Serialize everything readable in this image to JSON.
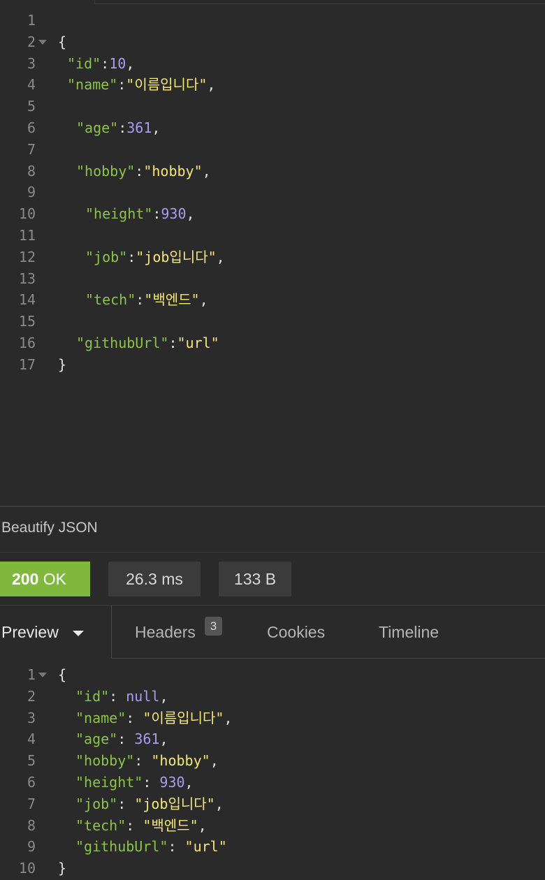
{
  "request_editor": {
    "lines": [
      {
        "num": "1",
        "tokens": []
      },
      {
        "num": "2",
        "fold": true,
        "tokens": [
          {
            "t": "p",
            "v": "{"
          }
        ]
      },
      {
        "num": "3",
        "indent": 1,
        "tokens": [
          {
            "t": "k",
            "v": "\"id\""
          },
          {
            "t": "p",
            "v": ":"
          },
          {
            "t": "n",
            "v": "10"
          },
          {
            "t": "p",
            "v": ","
          }
        ]
      },
      {
        "num": "4",
        "indent": 1,
        "tokens": [
          {
            "t": "k",
            "v": "\"name\""
          },
          {
            "t": "p",
            "v": ":"
          },
          {
            "t": "s",
            "v": "\"이름입니다\""
          },
          {
            "t": "p",
            "v": ","
          }
        ]
      },
      {
        "num": "5",
        "tokens": []
      },
      {
        "num": "6",
        "indent": 2,
        "tokens": [
          {
            "t": "k",
            "v": "\"age\""
          },
          {
            "t": "p",
            "v": ":"
          },
          {
            "t": "n",
            "v": "361"
          },
          {
            "t": "p",
            "v": ","
          }
        ]
      },
      {
        "num": "7",
        "tokens": []
      },
      {
        "num": "8",
        "indent": 2,
        "tokens": [
          {
            "t": "k",
            "v": "\"hobby\""
          },
          {
            "t": "p",
            "v": ":"
          },
          {
            "t": "s",
            "v": "\"hobby\""
          },
          {
            "t": "p",
            "v": ","
          }
        ]
      },
      {
        "num": "9",
        "tokens": []
      },
      {
        "num": "10",
        "indent": 3,
        "tokens": [
          {
            "t": "k",
            "v": "\"height\""
          },
          {
            "t": "p",
            "v": ":"
          },
          {
            "t": "n",
            "v": "930"
          },
          {
            "t": "p",
            "v": ","
          }
        ]
      },
      {
        "num": "11",
        "tokens": []
      },
      {
        "num": "12",
        "indent": 3,
        "tokens": [
          {
            "t": "k",
            "v": "\"job\""
          },
          {
            "t": "p",
            "v": ":"
          },
          {
            "t": "s",
            "v": "\"job입니다\""
          },
          {
            "t": "p",
            "v": ","
          }
        ]
      },
      {
        "num": "13",
        "tokens": []
      },
      {
        "num": "14",
        "indent": 3,
        "tokens": [
          {
            "t": "k",
            "v": "\"tech\""
          },
          {
            "t": "p",
            "v": ":"
          },
          {
            "t": "s",
            "v": "\"백엔드\""
          },
          {
            "t": "p",
            "v": ","
          }
        ]
      },
      {
        "num": "15",
        "tokens": []
      },
      {
        "num": "16",
        "indent": 2,
        "tokens": [
          {
            "t": "k",
            "v": "\"githubUrl\""
          },
          {
            "t": "p",
            "v": ":"
          },
          {
            "t": "s",
            "v": "\"url\""
          }
        ]
      },
      {
        "num": "17",
        "tokens": [
          {
            "t": "p",
            "v": "}"
          }
        ]
      }
    ]
  },
  "beautify_label": "Beautify JSON",
  "status": {
    "code": "200",
    "text": "OK",
    "time": "26.3 ms",
    "size": "133 B"
  },
  "tabs": {
    "preview": "Preview",
    "headers": "Headers",
    "headers_count": "3",
    "cookies": "Cookies",
    "timeline": "Timeline"
  },
  "response_preview": {
    "lines": [
      {
        "num": "1",
        "fold": true,
        "tokens": [
          {
            "t": "p",
            "v": "{"
          }
        ]
      },
      {
        "num": "2",
        "indent": 1,
        "tokens": [
          {
            "t": "k",
            "v": "\"id\""
          },
          {
            "t": "p",
            "v": ": "
          },
          {
            "t": "nl",
            "v": "null"
          },
          {
            "t": "p",
            "v": ","
          }
        ]
      },
      {
        "num": "3",
        "indent": 1,
        "tokens": [
          {
            "t": "k",
            "v": "\"name\""
          },
          {
            "t": "p",
            "v": ": "
          },
          {
            "t": "s",
            "v": "\"이름입니다\""
          },
          {
            "t": "p",
            "v": ","
          }
        ]
      },
      {
        "num": "4",
        "indent": 1,
        "tokens": [
          {
            "t": "k",
            "v": "\"age\""
          },
          {
            "t": "p",
            "v": ": "
          },
          {
            "t": "n",
            "v": "361"
          },
          {
            "t": "p",
            "v": ","
          }
        ]
      },
      {
        "num": "5",
        "indent": 1,
        "tokens": [
          {
            "t": "k",
            "v": "\"hobby\""
          },
          {
            "t": "p",
            "v": ": "
          },
          {
            "t": "s",
            "v": "\"hobby\""
          },
          {
            "t": "p",
            "v": ","
          }
        ]
      },
      {
        "num": "6",
        "indent": 1,
        "tokens": [
          {
            "t": "k",
            "v": "\"height\""
          },
          {
            "t": "p",
            "v": ": "
          },
          {
            "t": "n",
            "v": "930"
          },
          {
            "t": "p",
            "v": ","
          }
        ]
      },
      {
        "num": "7",
        "indent": 1,
        "tokens": [
          {
            "t": "k",
            "v": "\"job\""
          },
          {
            "t": "p",
            "v": ": "
          },
          {
            "t": "s",
            "v": "\"job입니다\""
          },
          {
            "t": "p",
            "v": ","
          }
        ]
      },
      {
        "num": "8",
        "indent": 1,
        "tokens": [
          {
            "t": "k",
            "v": "\"tech\""
          },
          {
            "t": "p",
            "v": ": "
          },
          {
            "t": "s",
            "v": "\"백엔드\""
          },
          {
            "t": "p",
            "v": ","
          }
        ]
      },
      {
        "num": "9",
        "indent": 1,
        "tokens": [
          {
            "t": "k",
            "v": "\"githubUrl\""
          },
          {
            "t": "p",
            "v": ": "
          },
          {
            "t": "s",
            "v": "\"url\""
          }
        ]
      },
      {
        "num": "10",
        "tokens": [
          {
            "t": "p",
            "v": "}"
          }
        ]
      }
    ]
  },
  "colors": {
    "background": "#2a2a2a",
    "status_ok": "#7fb83d",
    "json_key": "#8bc34a",
    "json_string": "#f3e77a",
    "json_number": "#a99df0"
  }
}
